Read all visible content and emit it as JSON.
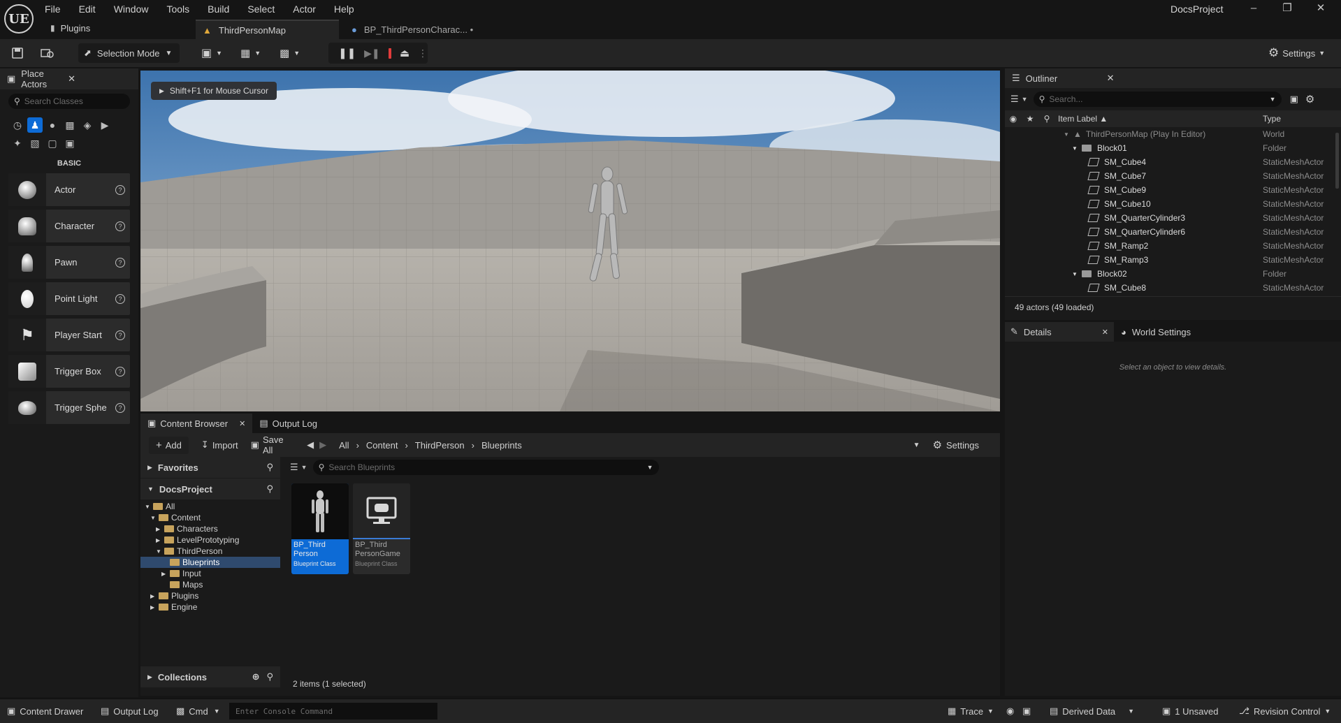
{
  "menu": [
    "File",
    "Edit",
    "Window",
    "Tools",
    "Build",
    "Select",
    "Actor",
    "Help"
  ],
  "app": {
    "logo": "UE",
    "window_title": "DocsProject",
    "plugins_label": "Plugins"
  },
  "doc_tabs": [
    {
      "label": "ThirdPersonMap",
      "active": true
    },
    {
      "label": "BP_ThirdPersonCharac... •",
      "active": false
    }
  ],
  "toolbar": {
    "selection_mode": "Selection Mode",
    "settings": "Settings"
  },
  "place_actors": {
    "tab_label": "Place Actors",
    "search_placeholder": "Search Classes",
    "section": "BASIC",
    "items": [
      "Actor",
      "Character",
      "Pawn",
      "Point Light",
      "Player Start",
      "Trigger Box",
      "Trigger Sphe"
    ]
  },
  "viewport": {
    "hint": "Shift+F1 for Mouse Cursor"
  },
  "content_browser": {
    "tabs": [
      "Content Browser",
      "Output Log"
    ],
    "add": "Add",
    "import": "Import",
    "save_all": "Save All",
    "breadcrumb": [
      "All",
      "Content",
      "ThirdPerson",
      "Blueprints"
    ],
    "settings": "Settings",
    "favorites": "Favorites",
    "project": "DocsProject",
    "tree": [
      {
        "label": "All",
        "depth": 0,
        "expanded": true
      },
      {
        "label": "Content",
        "depth": 1,
        "expanded": true
      },
      {
        "label": "Characters",
        "depth": 2,
        "expanded": false
      },
      {
        "label": "LevelPrototyping",
        "depth": 2,
        "expanded": false
      },
      {
        "label": "ThirdPerson",
        "depth": 2,
        "expanded": true
      },
      {
        "label": "Blueprints",
        "depth": 3,
        "selected": true
      },
      {
        "label": "Input",
        "depth": 3,
        "expanded": false
      },
      {
        "label": "Maps",
        "depth": 3
      },
      {
        "label": "Plugins",
        "depth": 1,
        "expanded": false
      },
      {
        "label": "Engine",
        "depth": 1,
        "expanded": false
      }
    ],
    "collections": "Collections",
    "search_placeholder": "Search Blueprints",
    "assets": [
      {
        "name": "BP_Third Person",
        "class": "Blueprint Class",
        "selected": true
      },
      {
        "name": "BP_Third PersonGame",
        "class": "Blueprint Class",
        "selected": false
      }
    ],
    "status": "2 items (1 selected)"
  },
  "outliner": {
    "tab_label": "Outliner",
    "search_placeholder": "Search...",
    "col_label": "Item Label ▲",
    "col_type": "Type",
    "rows": [
      {
        "label": "ThirdPersonMap (Play In Editor)",
        "type": "World",
        "depth": 0,
        "kind": "world"
      },
      {
        "label": "Block01",
        "type": "Folder",
        "depth": 1,
        "kind": "folder"
      },
      {
        "label": "SM_Cube4",
        "type": "StaticMeshActor",
        "depth": 2,
        "kind": "mesh"
      },
      {
        "label": "SM_Cube7",
        "type": "StaticMeshActor",
        "depth": 2,
        "kind": "mesh"
      },
      {
        "label": "SM_Cube9",
        "type": "StaticMeshActor",
        "depth": 2,
        "kind": "mesh"
      },
      {
        "label": "SM_Cube10",
        "type": "StaticMeshActor",
        "depth": 2,
        "kind": "mesh"
      },
      {
        "label": "SM_QuarterCylinder3",
        "type": "StaticMeshActor",
        "depth": 2,
        "kind": "mesh"
      },
      {
        "label": "SM_QuarterCylinder6",
        "type": "StaticMeshActor",
        "depth": 2,
        "kind": "mesh"
      },
      {
        "label": "SM_Ramp2",
        "type": "StaticMeshActor",
        "depth": 2,
        "kind": "mesh"
      },
      {
        "label": "SM_Ramp3",
        "type": "StaticMeshActor",
        "depth": 2,
        "kind": "mesh"
      },
      {
        "label": "Block02",
        "type": "Folder",
        "depth": 1,
        "kind": "folder"
      },
      {
        "label": "SM_Cube8",
        "type": "StaticMeshActor",
        "depth": 2,
        "kind": "mesh"
      }
    ],
    "status": "49 actors (49 loaded)"
  },
  "details": {
    "tab_label": "Details",
    "world_settings": "World Settings",
    "empty_msg": "Select an object to view details."
  },
  "statusbar": {
    "content_drawer": "Content Drawer",
    "output_log": "Output Log",
    "cmd": "Cmd",
    "console_placeholder": "Enter Console Command",
    "trace": "Trace",
    "derived_data": "Derived Data",
    "unsaved": "1 Unsaved",
    "revision_control": "Revision Control"
  },
  "colors": {
    "accent": "#0d6bd6",
    "panel": "#1a1a1a",
    "header": "#242424",
    "stop": "#e23b3b",
    "folder": "#c7a35c"
  }
}
